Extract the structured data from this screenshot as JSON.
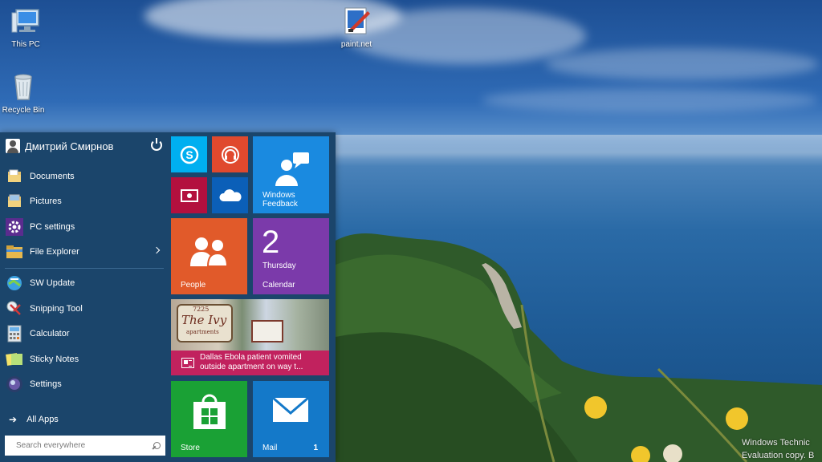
{
  "desktop": {
    "icons": [
      {
        "label": "This PC",
        "icon": "this-pc-icon"
      },
      {
        "label": "paint.net",
        "icon": "paintnet-icon"
      },
      {
        "label": "Recycle Bin",
        "icon": "recycle-bin-icon"
      }
    ],
    "watermark": {
      "line1": "Windows Technic",
      "line2": "Evaluation copy. B"
    }
  },
  "start_menu": {
    "user_name": "Дмитрий Смирнов",
    "places": [
      {
        "label": "Documents",
        "icon": "documents-folder-icon"
      },
      {
        "label": "Pictures",
        "icon": "pictures-folder-icon"
      },
      {
        "label": "PC settings",
        "icon": "pc-settings-gear-icon"
      },
      {
        "label": "File Explorer",
        "icon": "file-explorer-icon"
      }
    ],
    "apps": [
      {
        "label": "SW Update",
        "icon": "sw-update-icon"
      },
      {
        "label": "Snipping Tool",
        "icon": "snipping-tool-icon"
      },
      {
        "label": "Calculator",
        "icon": "calculator-icon"
      },
      {
        "label": "Sticky Notes",
        "icon": "sticky-notes-icon"
      },
      {
        "label": "Settings",
        "icon": "settings-icon"
      }
    ],
    "all_apps": "All Apps",
    "search_placeholder": "Search everywhere",
    "tiles": {
      "skype": {
        "color": "#00aff0",
        "icon": "skype-icon"
      },
      "music": {
        "color": "#e0492e",
        "icon": "headphones-icon"
      },
      "video": {
        "color": "#b3103e",
        "icon": "video-icon"
      },
      "onedrive": {
        "color": "#0b5fb8",
        "icon": "onedrive-cloud-icon"
      },
      "feedback": {
        "line1": "Windows",
        "line2": "Feedback",
        "color": "#1a8ae0",
        "icon": "feedback-people-icon"
      },
      "people": {
        "label": "People",
        "color": "#e15a2a",
        "icon": "people-icon"
      },
      "calendar": {
        "label": "Calendar",
        "day": "2",
        "weekday": "Thursday",
        "color": "#7b3aaa"
      },
      "news": {
        "line1": "Dallas Ebola patient vomited",
        "line2": "outside apartment on way t...",
        "sign_number": "7225",
        "sign_line1": "The Ivy",
        "sign_line2": "apartments",
        "color": "#c1225e",
        "icon": "news-icon"
      },
      "store": {
        "label": "Store",
        "color": "#1aa135",
        "icon": "store-bag-icon"
      },
      "mail": {
        "label": "Mail",
        "count": "1",
        "color": "#1479c9",
        "icon": "mail-envelope-icon"
      }
    }
  }
}
